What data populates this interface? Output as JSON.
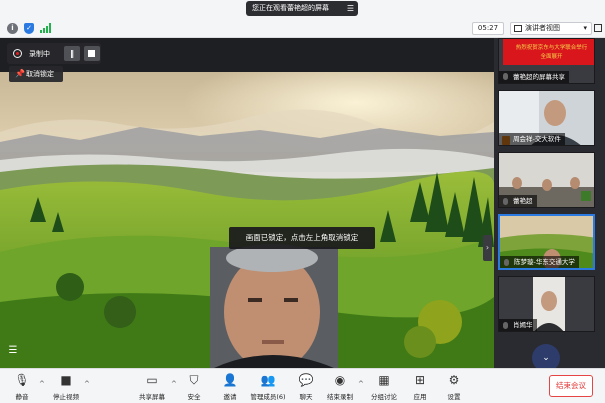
{
  "top": {
    "share_banner": "您正在观看蕾艳超的屏幕",
    "timer": "05:27",
    "view_mode": "演讲者视图"
  },
  "stage": {
    "recording_label": "录制中",
    "unlock_label": "取消锁定",
    "lock_tip": "画面已锁定，点击左上角取消锁定"
  },
  "panel": {
    "banner_lines": [
      "热烈祝贺京东与大学联合举行",
      "全面展开"
    ],
    "tiles": [
      {
        "name": "蕾艳超的屏幕共享",
        "mic": "white"
      },
      {
        "name": "周会祥-交大软件",
        "mic": "orange"
      },
      {
        "name": "蕾艳超",
        "mic": "white"
      },
      {
        "name": "陈梦璇-华东交通大学",
        "mic": "white"
      },
      {
        "name": "肖嫣华",
        "mic": "white"
      }
    ]
  },
  "toolbar": {
    "items": [
      {
        "label": "静音",
        "icon": "microphone-icon"
      },
      {
        "label": "停止视频",
        "icon": "video-camera-icon"
      },
      {
        "label": "共享屏幕",
        "icon": "share-screen-icon"
      },
      {
        "label": "安全",
        "icon": "shield-icon"
      },
      {
        "label": "邀请",
        "icon": "invite-icon"
      },
      {
        "label": "管理成员(6)",
        "icon": "members-icon"
      },
      {
        "label": "聊天",
        "icon": "chat-icon"
      },
      {
        "label": "结束录制",
        "icon": "stop-record-icon"
      },
      {
        "label": "分组讨论",
        "icon": "breakout-icon"
      },
      {
        "label": "应用",
        "icon": "apps-icon"
      },
      {
        "label": "设置",
        "icon": "gear-icon"
      }
    ],
    "end_label": "结束会议"
  },
  "colors": {
    "accent": "#2a7ae2",
    "end": "#e23636",
    "recording": "#e02020",
    "banner": "#d8161b"
  }
}
